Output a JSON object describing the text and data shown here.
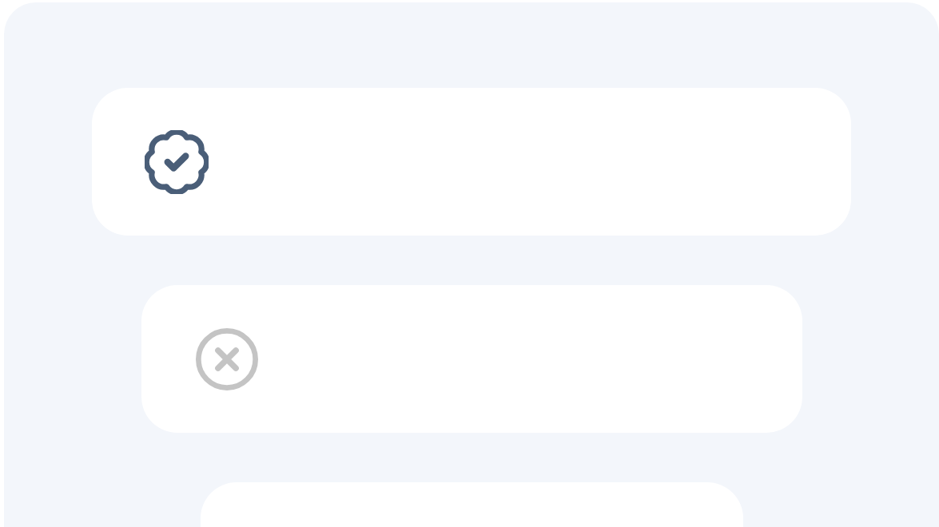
{
  "cards": [
    {
      "kind": "verified"
    },
    {
      "kind": "rejected"
    },
    {
      "kind": "empty"
    }
  ]
}
